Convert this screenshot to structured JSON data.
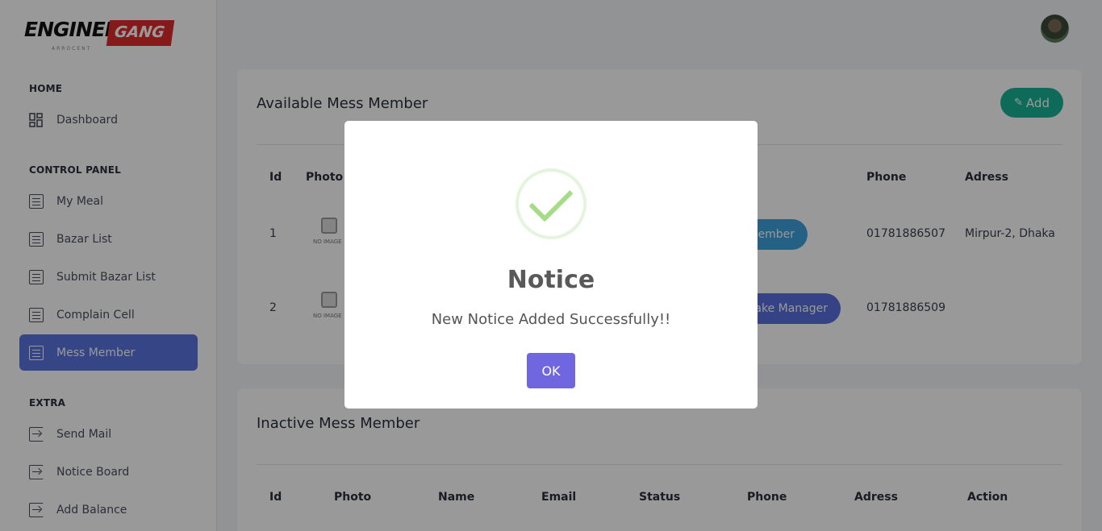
{
  "logo": {
    "main": "ENGINEER",
    "badge": "GANG",
    "tagline": "ARROCENT"
  },
  "sidebar": {
    "sections": [
      {
        "label": "HOME"
      },
      {
        "label": "CONTROL PANEL"
      },
      {
        "label": "EXTRA"
      }
    ],
    "items": [
      {
        "label": "Dashboard",
        "icon": "dashboard-icon"
      },
      {
        "label": "My Meal",
        "icon": "list-icon"
      },
      {
        "label": "Bazar List",
        "icon": "list-icon"
      },
      {
        "label": "Submit Bazar List",
        "icon": "list-icon"
      },
      {
        "label": "Complain Cell",
        "icon": "list-icon"
      },
      {
        "label": "Mess Member",
        "icon": "list-icon",
        "active": true
      },
      {
        "label": "Send Mail",
        "icon": "exit-icon"
      },
      {
        "label": "Notice Board",
        "icon": "exit-icon"
      },
      {
        "label": "Add Balance",
        "icon": "exit-icon"
      }
    ]
  },
  "available": {
    "title": "Available Mess Member",
    "add_label": "Add",
    "headers": {
      "id": "Id",
      "photo": "Photo",
      "phone": "Phone",
      "address": "Adress"
    },
    "rows": [
      {
        "id": "1",
        "photo_caption": "NO IMAGE",
        "action": "ember",
        "phone": "01781886507",
        "address": "Mirpur-2, Dhaka"
      },
      {
        "id": "2",
        "photo_caption": "NO IMAGE",
        "action": "ake Manager",
        "phone": "01781886509",
        "address": ""
      }
    ]
  },
  "inactive": {
    "title": "Inactive Mess Member",
    "headers": [
      "Id",
      "Photo",
      "Name",
      "Email",
      "Status",
      "Phone",
      "Adress",
      "Action"
    ]
  },
  "modal": {
    "title": "Notice",
    "message": "New Notice Added Successfully!!",
    "ok_label": "OK"
  },
  "colors": {
    "active_nav": "#5a74e0",
    "add_button": "#19b394",
    "ok_button": "#7066e0",
    "success": "#a5dc86"
  }
}
